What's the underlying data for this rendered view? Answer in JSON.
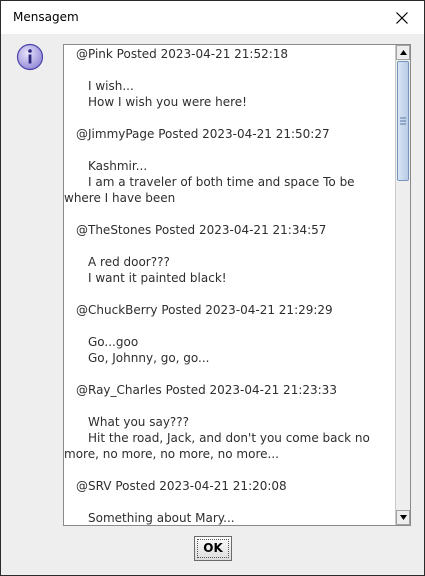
{
  "window": {
    "title": "Mensagem"
  },
  "messages": [
    {
      "header": "@Pink Posted 2023-04-21 21:52:18",
      "lines": [
        "I wish...",
        "How I wish you were here!"
      ]
    },
    {
      "header": "@JimmyPage Posted 2023-04-21 21:50:27",
      "lines": [
        "Kashmir...",
        "I am a traveler of both time and space To be where I have been"
      ]
    },
    {
      "header": "@TheStones Posted 2023-04-21 21:34:57",
      "lines": [
        "A red door???",
        "I want it painted black!"
      ]
    },
    {
      "header": "@ChuckBerry Posted 2023-04-21 21:29:29",
      "lines": [
        "Go...goo",
        "Go, Johnny, go, go..."
      ]
    },
    {
      "header": "@Ray_Charles Posted 2023-04-21 21:23:33",
      "lines": [
        "What you say???",
        "Hit the road, Jack, and don't you come back no more, no more, no more, no more..."
      ]
    },
    {
      "header": "@SRV Posted 2023-04-21 21:20:08",
      "lines": [
        "Something about Mary..."
      ]
    }
  ],
  "buttons": {
    "ok_label": "OK"
  },
  "icons": {
    "dialog": "info-icon",
    "close": "close-icon"
  }
}
